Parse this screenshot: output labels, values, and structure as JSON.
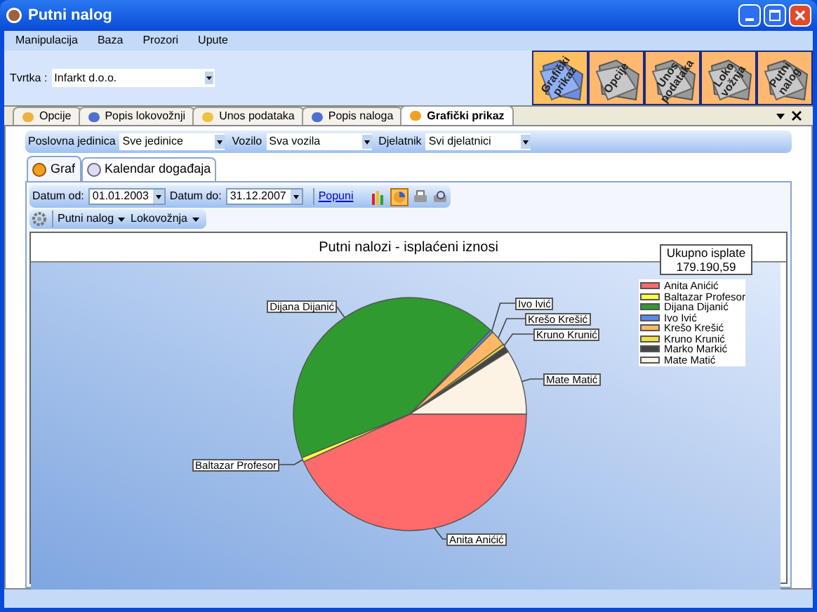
{
  "window": {
    "title": "Putni nalog"
  },
  "menu": [
    "Manipulacija",
    "Baza",
    "Prozori",
    "Upute"
  ],
  "company": {
    "label": "Tvrtka :",
    "value": "Infarkt d.o.o."
  },
  "big_buttons": [
    {
      "label": "Grafički prikaz",
      "selected": true
    },
    {
      "label": "Opcije",
      "selected": false
    },
    {
      "label": "Unos podataka",
      "selected": false
    },
    {
      "label": "Loko vožnja",
      "selected": false
    },
    {
      "label": "Putni nalog",
      "selected": false
    }
  ],
  "tabs": [
    {
      "label": "Opcije",
      "selected": false
    },
    {
      "label": "Popis lokovožnji",
      "selected": false
    },
    {
      "label": "Unos podataka",
      "selected": false
    },
    {
      "label": "Popis naloga",
      "selected": false
    },
    {
      "label": "Grafički prikaz",
      "selected": true
    }
  ],
  "filters": [
    {
      "label": "Poslovna jedinica",
      "value": "Sve jedinice"
    },
    {
      "label": "Vozilo",
      "value": "Sva vozila"
    },
    {
      "label": "Djelatnik",
      "value": "Svi djelatnici"
    }
  ],
  "sub_tabs": [
    {
      "label": "Graf",
      "selected": true
    },
    {
      "label": "Kalendar događaja",
      "selected": false
    }
  ],
  "date_from": {
    "label": "Datum od:",
    "value": "01.01.2003"
  },
  "date_to": {
    "label": "Datum do:",
    "value": "31.12.2007"
  },
  "refresh_link": "Popuni",
  "chart_type": {
    "bar_selected": false,
    "pie_selected": true
  },
  "menus": [
    "Putni nalog",
    "Lokovožnja"
  ],
  "chart": {
    "title": "Putni nalozi - isplaćeni iznosi",
    "total_label": "Ukupno isplate",
    "total_value": "179.190,59",
    "slices": [
      {
        "name": "Anita Anićić",
        "color": "#ff6a6a",
        "label": "Anita Anićić"
      },
      {
        "name": "Baltazar Profesor",
        "color": "#ffff40",
        "label": "Baltazar Profesor"
      },
      {
        "name": "Dijana Dijanić",
        "color": "#2f9a2f",
        "label": "Dijana Dijanić"
      },
      {
        "name": "Ivo Ivić",
        "color": "#5a8ae8",
        "label": "Ivo Ivić"
      },
      {
        "name": "Krešo Krešić",
        "color": "#ffb868",
        "label": "Krešo Krešić"
      },
      {
        "name": "Kruno Krunić",
        "color": "#f0e040",
        "label": "Kruno Krunić"
      },
      {
        "name": "Marko Markić",
        "color": "#444444"
      },
      {
        "name": "Mate Matić",
        "color": "#fdf3e4",
        "label": "Mate Matić"
      }
    ]
  }
}
